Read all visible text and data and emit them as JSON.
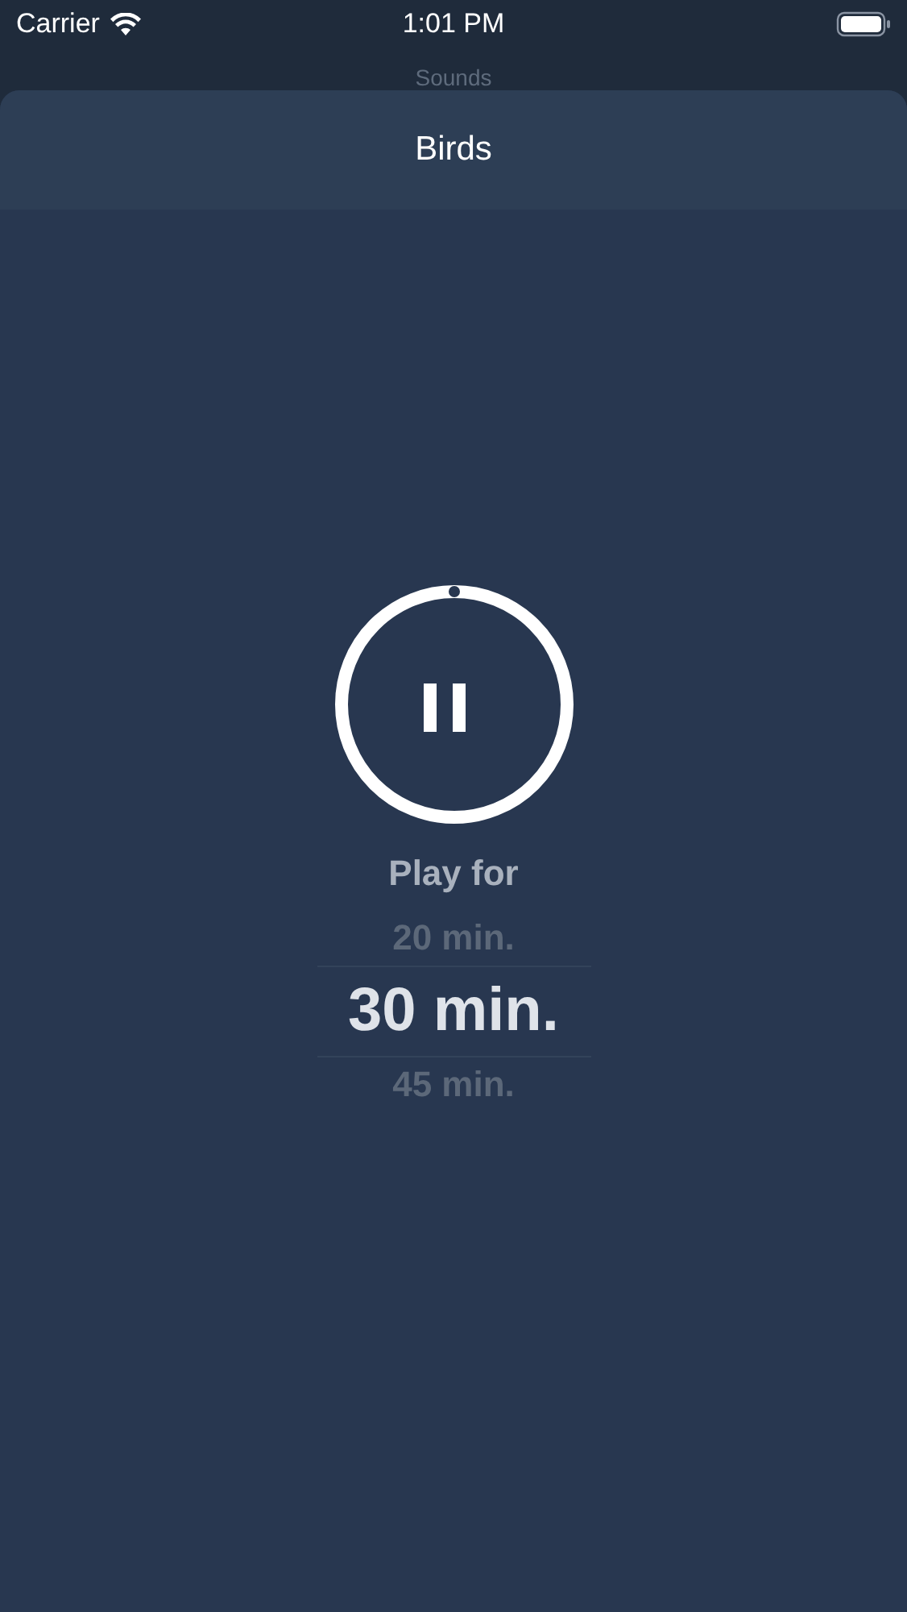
{
  "status_bar": {
    "carrier": "Carrier",
    "time": "1:01 PM"
  },
  "background_title": "Sounds",
  "sheet": {
    "title": "Birds"
  },
  "player": {
    "playing": true
  },
  "timer": {
    "label": "Play for",
    "options": [
      {
        "label": "20 min.",
        "selected": false
      },
      {
        "label": "30 min.",
        "selected": true
      },
      {
        "label": "45 min.",
        "selected": false
      }
    ]
  }
}
